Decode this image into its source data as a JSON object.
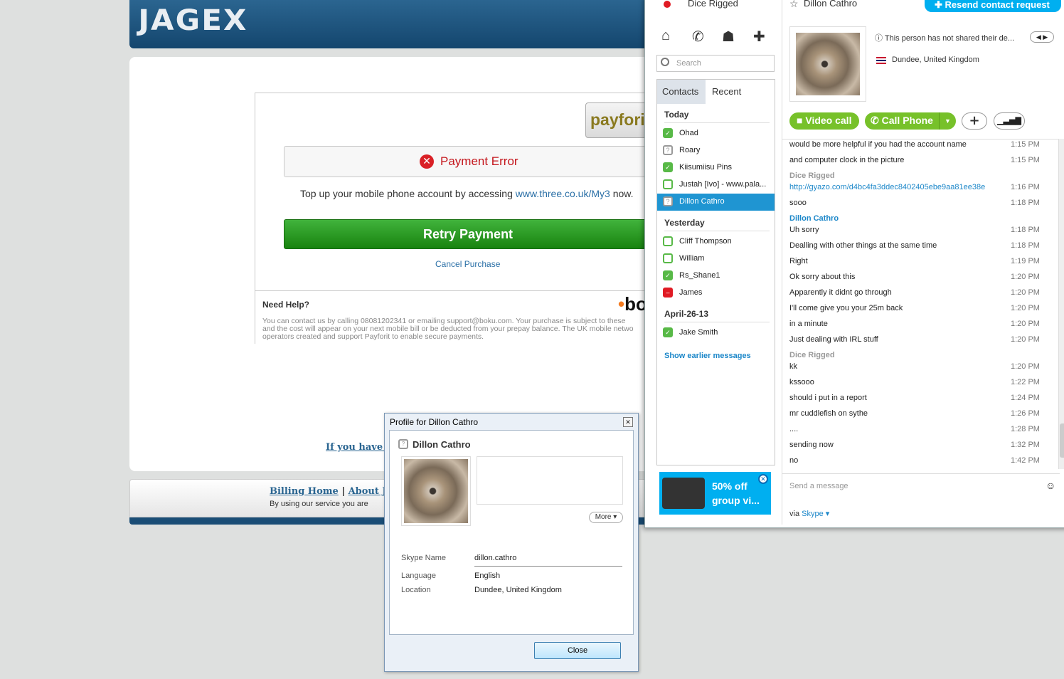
{
  "jagex": {
    "logo": "JAGEX",
    "payforit_logo": "payforit",
    "error_title": "Payment Error",
    "topup_text": "Top up your mobile phone account by accessing ",
    "topup_link": "www.three.co.uk/My3",
    "topup_suffix": " now.",
    "retry_label": "Retry Payment",
    "cancel_label": "Cancel Purchase",
    "help_heading": "Need Help?",
    "help_line1": "You can contact us by calling 08081202341 or emailing support@boku.com. Your purchase is subject to these",
    "help_line2": "and the cost will appear on your next mobile bill or be deducted from your prepay balance. The UK mobile netwo",
    "help_line3": "operators created and support Payforit to enable secure payments.",
    "boku_logo": "bo",
    "if_you_have": "If you have a",
    "footer_billing": "Billing Home",
    "footer_sep": " | ",
    "footer_about": "About Jag",
    "footer_sub": "By using our service you are"
  },
  "skype": {
    "my_name": "Dice Rigged",
    "search_placeholder": "Search",
    "tabs": [
      "Contacts",
      "Recent"
    ],
    "groups": [
      "Today",
      "Yesterday",
      "April-26-13"
    ],
    "contacts_today": [
      "Ohad",
      "Roary",
      "Kiisumiisu Pins",
      "Justah [Ivo] - www.pala...",
      "Dillon Cathro"
    ],
    "contacts_yesterday": [
      "Cliff Thompson",
      "William",
      "Rs_Shane1",
      "James"
    ],
    "contacts_april": [
      "Jake Smith"
    ],
    "show_earlier": "Show earlier messages",
    "promo": "50% off group vi...",
    "promo_line1": "50% off",
    "promo_line2": "group vi...",
    "conv_name": "Dillon Cathro",
    "resend": "Resend contact request",
    "mood": "This person has not shared their de...",
    "location": "Dundee, United Kingdom",
    "video_call": "Video call",
    "call_phone": "Call Phone",
    "messages": [
      {
        "text": "would be more helpful if you had the account name",
        "time": "1:15 PM"
      },
      {
        "text": "and computer clock in the picture",
        "time": "1:15 PM"
      },
      {
        "sender": "Dice Rigged"
      },
      {
        "text": "http://gyazo.com/d4bc4fa3ddec8402405ebe9aa81ee38e",
        "time": "1:16 PM",
        "link": true
      },
      {
        "text": "sooo",
        "time": "1:18 PM"
      },
      {
        "sender": "Dillon Cathro",
        "blue": true
      },
      {
        "text": "Uh sorry",
        "time": "1:18 PM"
      },
      {
        "text": "Dealling with other things at the same time",
        "time": "1:18 PM"
      },
      {
        "text": "Right",
        "time": "1:19 PM"
      },
      {
        "text": "Ok sorry about this",
        "time": "1:20 PM"
      },
      {
        "text": "Apparently it didnt go through",
        "time": "1:20 PM"
      },
      {
        "text": "I'll come give you your 25m back",
        "time": "1:20 PM"
      },
      {
        "text": "in a minute",
        "time": "1:20 PM"
      },
      {
        "text": "Just dealing with IRL stuff",
        "time": "1:20 PM"
      },
      {
        "sender": "Dice Rigged"
      },
      {
        "text": "kk",
        "time": "1:20 PM"
      },
      {
        "text": "kssooo",
        "time": "1:22 PM"
      },
      {
        "text": "should i put in a report",
        "time": "1:24 PM"
      },
      {
        "text": "mr cuddlefish on sythe",
        "time": "1:26 PM"
      },
      {
        "text": "....",
        "time": "1:28 PM"
      },
      {
        "text": "sending now",
        "time": "1:32 PM"
      },
      {
        "text": "no",
        "time": "1:42 PM"
      }
    ],
    "compose_placeholder": "Send a message",
    "via": "via ",
    "via_service": "Skype"
  },
  "profile": {
    "title": "Profile for Dillon Cathro",
    "name": "Dillon Cathro",
    "more": "More",
    "skype_name_label": "Skype Name",
    "skype_name": "dillon.cathro",
    "language_label": "Language",
    "language": "English",
    "location_label": "Location",
    "location": "Dundee, United Kingdom",
    "close": "Close"
  }
}
